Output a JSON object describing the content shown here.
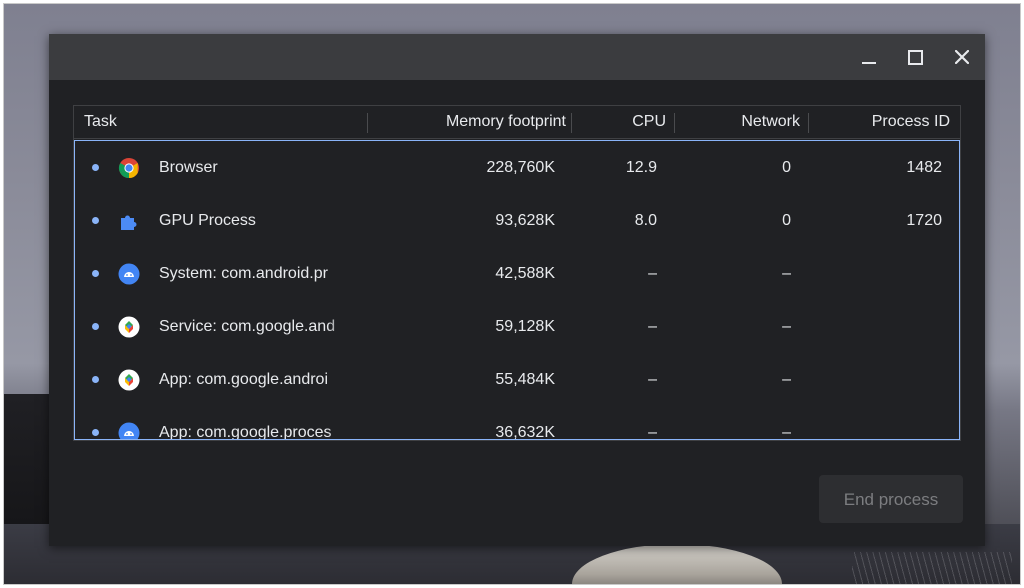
{
  "window": {
    "controls": {
      "minimize_icon": "minimize-icon",
      "maximize_icon": "maximize-icon",
      "close_icon": "close-icon",
      "close_glyph": "✕"
    }
  },
  "table": {
    "headers": {
      "task": "Task",
      "memory": "Memory footprint",
      "cpu": "CPU",
      "network": "Network",
      "pid": "Process ID"
    },
    "rows": [
      {
        "icon": "chrome-icon",
        "task": "Browser",
        "memory": "228,760K",
        "cpu": "12.9",
        "network": "0",
        "pid": "1482"
      },
      {
        "icon": "puzzle-icon",
        "task": "GPU Process",
        "memory": "93,628K",
        "cpu": "8.0",
        "network": "0",
        "pid": "1720"
      },
      {
        "icon": "android-icon",
        "task": "System: com.android.pr",
        "memory": "42,588K",
        "cpu": "–",
        "network": "–",
        "pid": ""
      },
      {
        "icon": "google-play-services-icon",
        "task": "Service: com.google.and",
        "memory": "59,128K",
        "cpu": "–",
        "network": "–",
        "pid": ""
      },
      {
        "icon": "google-play-services-icon",
        "task": "App: com.google.androi",
        "memory": "55,484K",
        "cpu": "–",
        "network": "–",
        "pid": ""
      },
      {
        "icon": "android-icon",
        "task": "App: com.google.proces",
        "memory": "36,632K",
        "cpu": "–",
        "network": "–",
        "pid": ""
      }
    ]
  },
  "footer": {
    "end_process_label": "End process"
  },
  "colors": {
    "window_bg": "#202124",
    "titlebar_bg": "#3b3c3f",
    "accent_blue": "#8ab4f8",
    "text": "#e8eaed",
    "disabled_text": "#7c7d80"
  }
}
